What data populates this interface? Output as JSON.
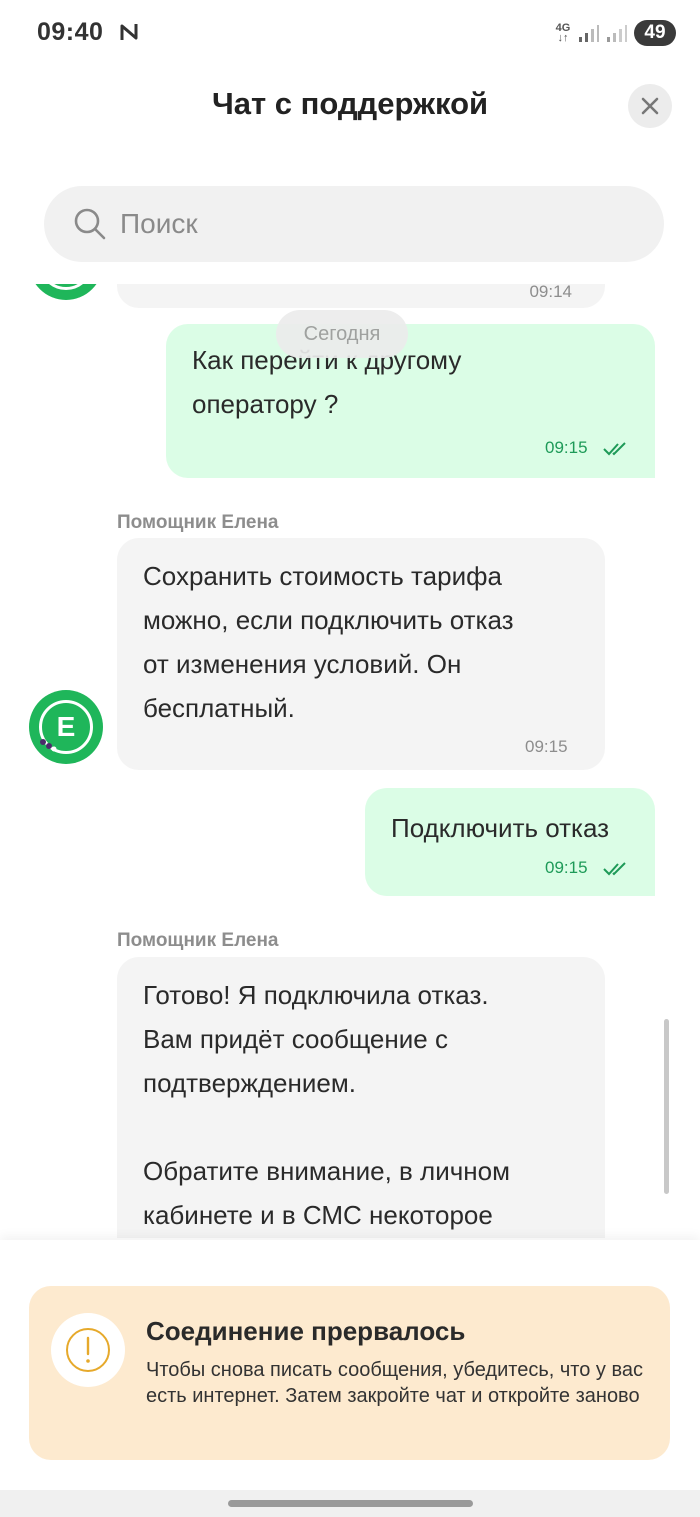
{
  "status_bar": {
    "time": "09:40",
    "network_type": "4G",
    "battery": "49",
    "notification_icon": "n-icon"
  },
  "header": {
    "title": "Чат с поддержкой",
    "close_icon": "close-icon"
  },
  "search": {
    "placeholder": "Поиск",
    "icon": "search-icon"
  },
  "chat": {
    "date_separator": "Сегодня",
    "partial_message_time": "09:14",
    "messages": [
      {
        "direction": "out",
        "text": "Как перейти к другому\nоператору ?",
        "time": "09:15",
        "status": "read"
      },
      {
        "direction": "in",
        "sender": "Помощник Елена",
        "avatar_letter": "Е",
        "text": "Сохранить стоимость тарифа\nможно, если подключить отказ\nот изменения условий. Он\nбесплатный.",
        "time": "09:15"
      },
      {
        "direction": "out",
        "text": "Подключить отказ",
        "time": "09:15",
        "status": "read"
      },
      {
        "direction": "in",
        "sender": "Помощник Елена",
        "text": "Готово! Я подключила отказ.\nВам придёт сообщение с\nподтверждением.\n\nОбратите внимание, в личном\nкабинете и в СМС некоторое"
      }
    ]
  },
  "alert": {
    "title": "Соединение прервалось",
    "text": "Чтобы снова писать сообщения, убедитесь, что у вас есть интернет. Затем закройте чат и откройте заново",
    "icon": "exclamation-circle-icon",
    "background": "#fdeacf",
    "accent": "#e6a92b"
  },
  "colors": {
    "outgoing_bubble": "#dbfde6",
    "incoming_bubble": "#f4f4f4",
    "brand_green": "#1fb65a",
    "read_check": "#1e9a58"
  }
}
